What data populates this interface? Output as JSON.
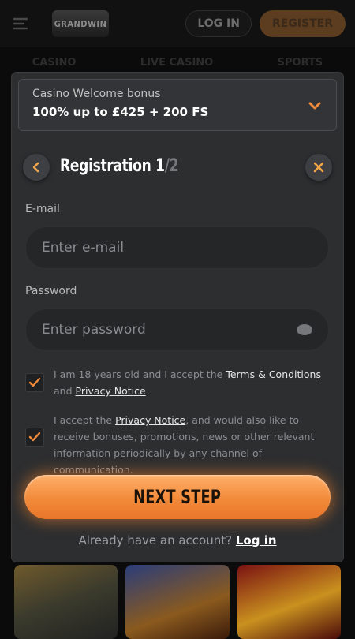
{
  "background": {
    "logo_text": "GRANDWIN",
    "login_label": "LOG IN",
    "register_label": "REGISTER",
    "nav_tabs": [
      "CASINO",
      "LIVE CASINO",
      "SPORTS"
    ]
  },
  "bonus": {
    "title": "Casino Welcome bonus",
    "value": "100% up to £425 + 200 FS"
  },
  "registration": {
    "title": "Registration 1",
    "step_suffix": "/2",
    "email_label": "E-mail",
    "email_placeholder": "Enter e-mail",
    "password_label": "Password",
    "password_placeholder": "Enter password",
    "consent1_pre": "I am 18 years old and I accept the",
    "consent1_link1": "Terms & Conditions",
    "consent1_and": "and",
    "consent1_link2": "Privacy Notice",
    "consent2_pre": "I accept the",
    "consent2_link": "Privacy Notice",
    "consent2_post": ", and would also like to receive bonuses, promotions, news or other relevant information periodically by any channel of communication.",
    "next_label": "NEXT STEP",
    "already_text": "Already have an account?",
    "login_link": "Log in"
  },
  "colors": {
    "accent": "#f28a3a",
    "modal_bg": "#2d2e30",
    "field_bg": "#252628"
  }
}
